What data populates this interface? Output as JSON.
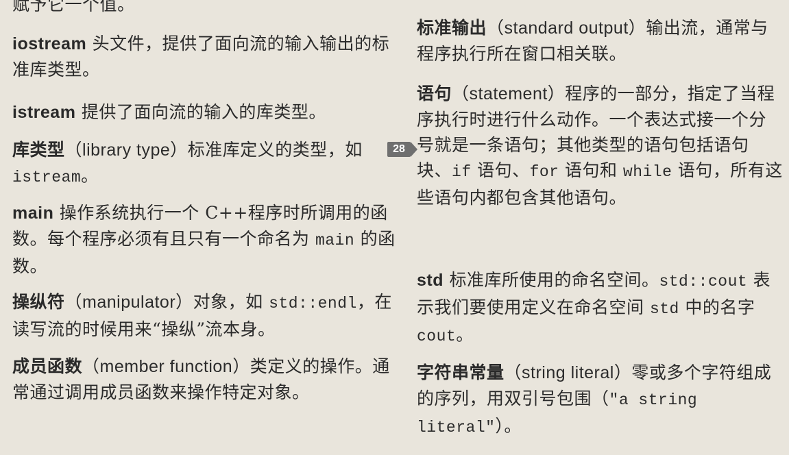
{
  "page_marker": "28",
  "left": {
    "e0": {
      "text": "赋予它一个值。"
    },
    "e1": {
      "term": "iostream",
      "text": " 头文件，提供了面向流的输入输出的标准库类型。"
    },
    "e2": {
      "term": "istream",
      "text": " 提供了面向流的输入的库类型。"
    },
    "e3": {
      "term": "库类型",
      "paren": "（library type）",
      "text": "标准库定义的类型，如 ",
      "code": "istream",
      "tail": "。"
    },
    "e4": {
      "term": "main",
      "text": " 操作系统执行一个 C++程序时所调用的函数。每个程序必须有且只有一个命名为 ",
      "code": "main",
      "tail": " 的函数。"
    },
    "e5": {
      "term": "操纵符",
      "paren": "（manipulator）",
      "text": "对象，如 ",
      "code": "std::endl",
      "tail": "，在读写流的时候用来“操纵”流本身。"
    },
    "e6": {
      "term": "成员函数",
      "paren": "（member function）",
      "text": "类定义的操作。通常通过调用成员函数来操作特定对象。"
    }
  },
  "right": {
    "e1": {
      "term": "标准输出",
      "paren": "（standard output）",
      "text": "输出流，通常与程序执行所在窗口相关联。"
    },
    "e2": {
      "term": "语句",
      "paren": "（statement）",
      "text": "程序的一部分，指定了当程序执行时进行什么动作。一个表达式接一个分号就是一条语句；其他类型的语句包括语句块、",
      "code1": "if",
      "mid1": " 语句、",
      "code2": "for",
      "mid2": " 语句和 ",
      "code3": "while",
      "tail": " 语句，所有这些语句内都包含其他语句。"
    },
    "e3": {
      "term": "std",
      "text": " 标准库所使用的命名空间。",
      "code1": "std::cout",
      "mid": " 表示我们要使用定义在命名空间 ",
      "code2": "std",
      "mid2": " 中的名字 ",
      "code3": "cout",
      "tail": "。"
    },
    "e4": {
      "term": "字符串常量",
      "paren": "（string literal）",
      "text": "零或多个字符组成的序列，用双引号包围（",
      "code": "\"a string literal\"",
      "tail": "）。"
    }
  }
}
